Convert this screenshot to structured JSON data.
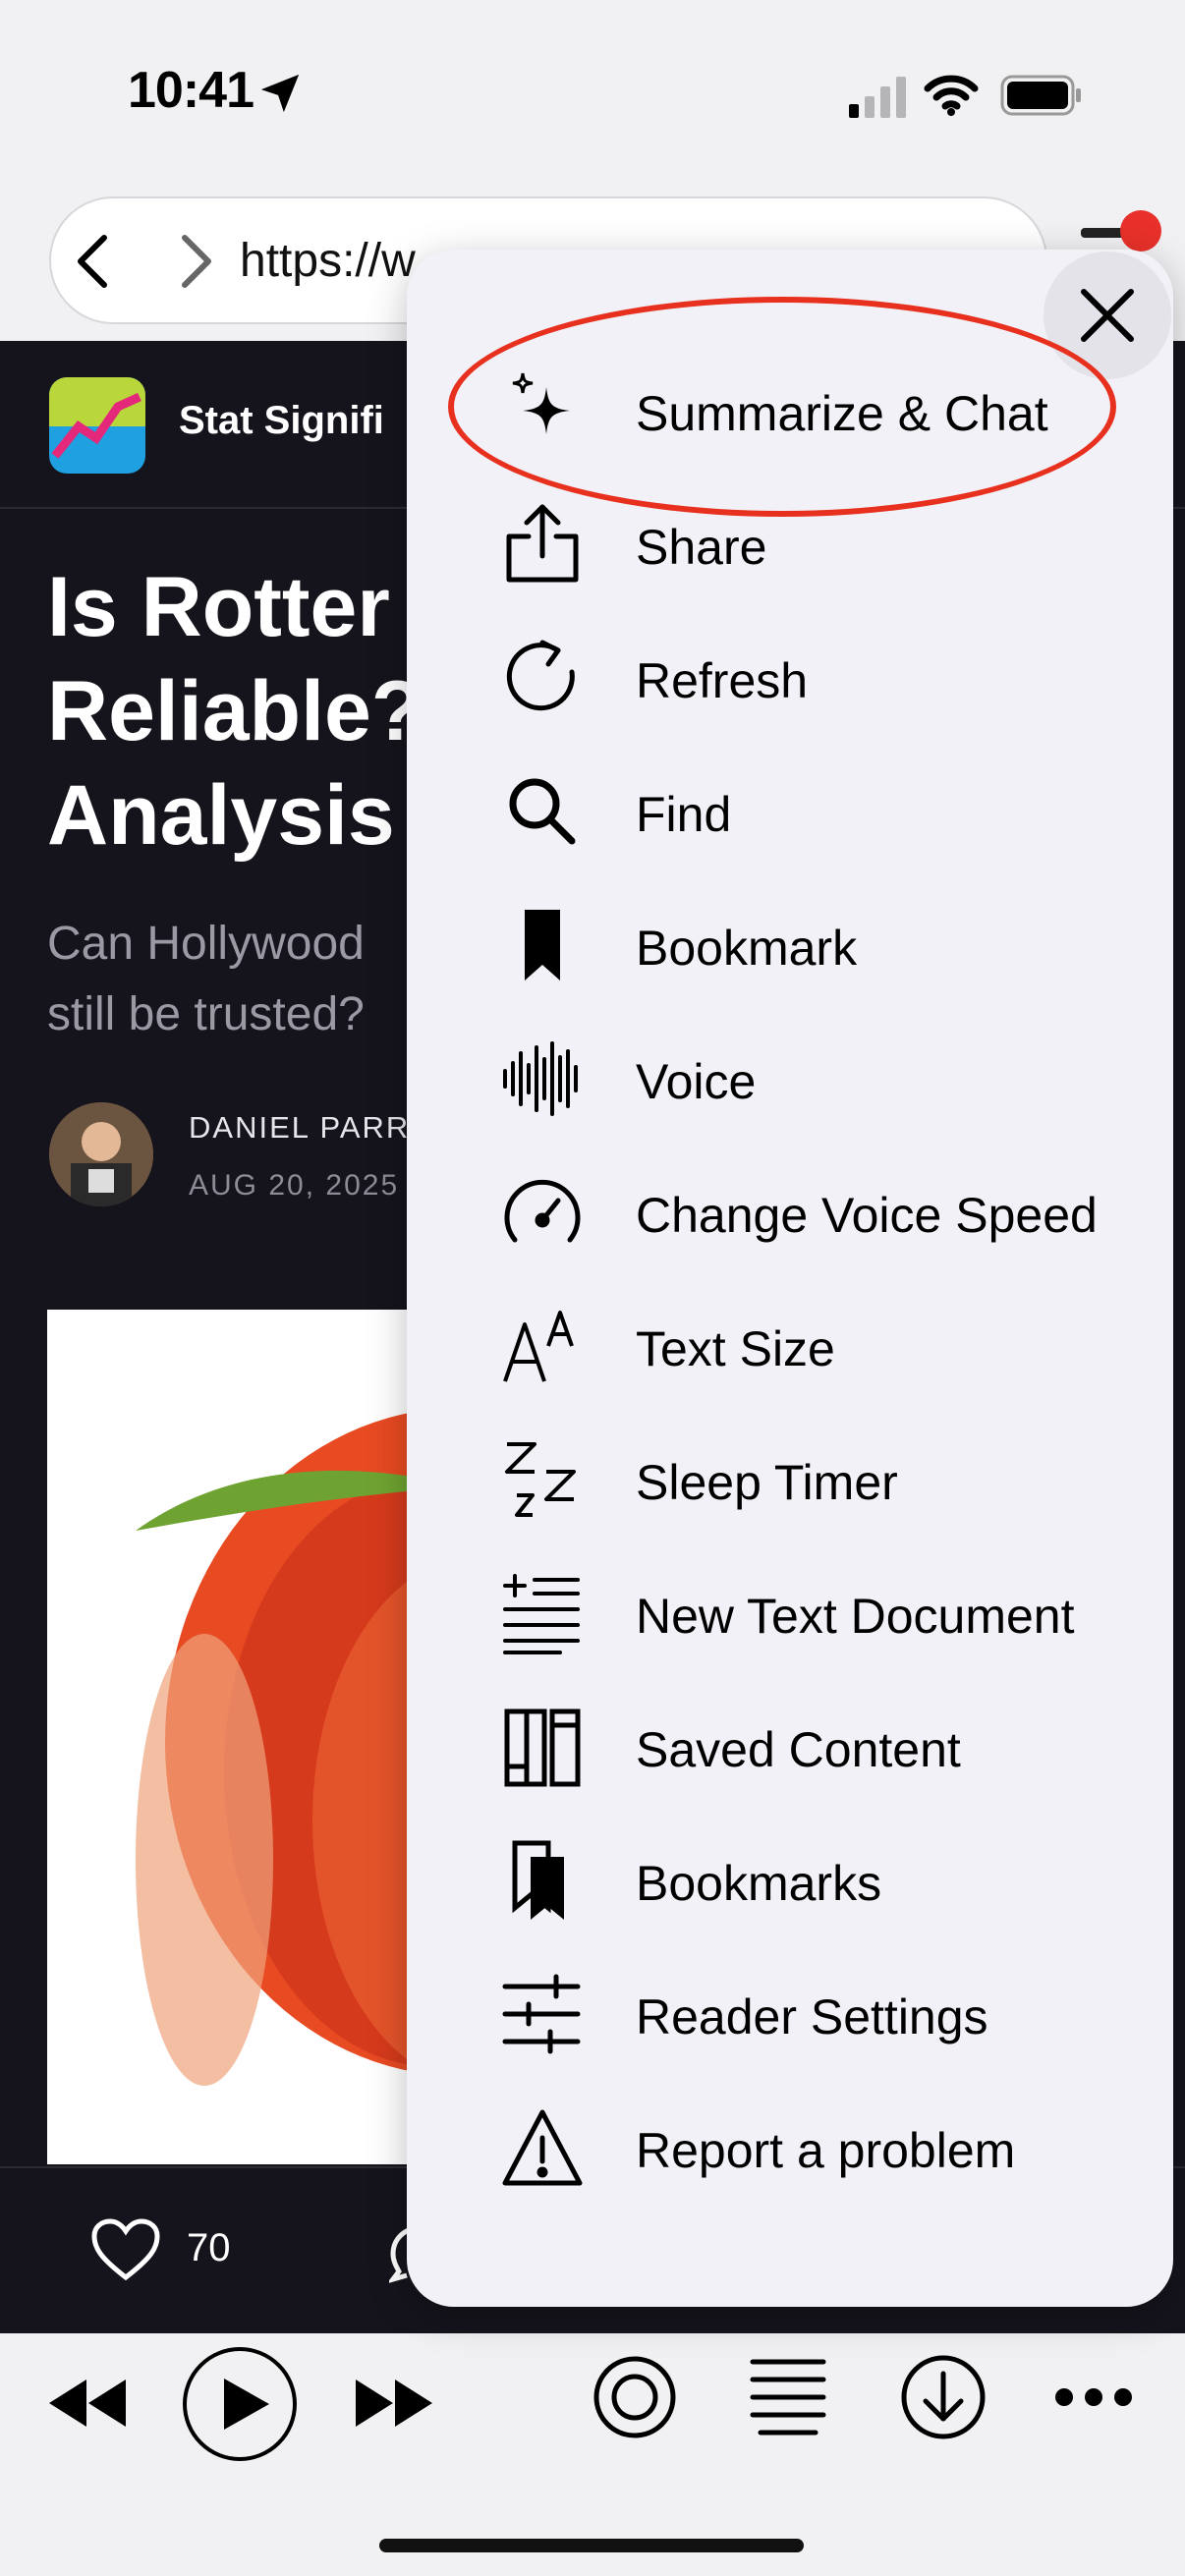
{
  "status_bar": {
    "time": "10:41"
  },
  "browser": {
    "url": "https://w",
    "menu_badge_color": "#e8312a"
  },
  "article": {
    "publication": "Stat Signifi",
    "headline": "Is Rotter\nReliable?\nAnalysis",
    "subtitle": "Can Hollywood\nstill be trusted?",
    "author": "DANIEL PARR",
    "date": "AUG 20, 2025",
    "likes": "70"
  },
  "menu": {
    "highlight_color": "#e8301f",
    "items": [
      {
        "label": "Summarize & Chat",
        "icon": "sparkles-icon"
      },
      {
        "label": "Share",
        "icon": "share-icon"
      },
      {
        "label": "Refresh",
        "icon": "refresh-icon"
      },
      {
        "label": "Find",
        "icon": "search-icon"
      },
      {
        "label": "Bookmark",
        "icon": "bookmark-icon"
      },
      {
        "label": "Voice",
        "icon": "waveform-icon"
      },
      {
        "label": "Change Voice Speed",
        "icon": "speedometer-icon"
      },
      {
        "label": "Text Size",
        "icon": "text-size-icon"
      },
      {
        "label": "Sleep Timer",
        "icon": "sleep-icon"
      },
      {
        "label": "New Text Document",
        "icon": "text-document-icon"
      },
      {
        "label": "Saved Content",
        "icon": "library-icon"
      },
      {
        "label": "Bookmarks",
        "icon": "bookmarks-icon"
      },
      {
        "label": "Reader Settings",
        "icon": "sliders-icon"
      },
      {
        "label": "Report a problem",
        "icon": "warning-icon"
      }
    ]
  },
  "player": {
    "buttons": [
      "rewind-icon",
      "play-icon",
      "fast-forward-icon",
      "record-icon",
      "text-lines-icon",
      "download-icon",
      "more-icon"
    ]
  }
}
